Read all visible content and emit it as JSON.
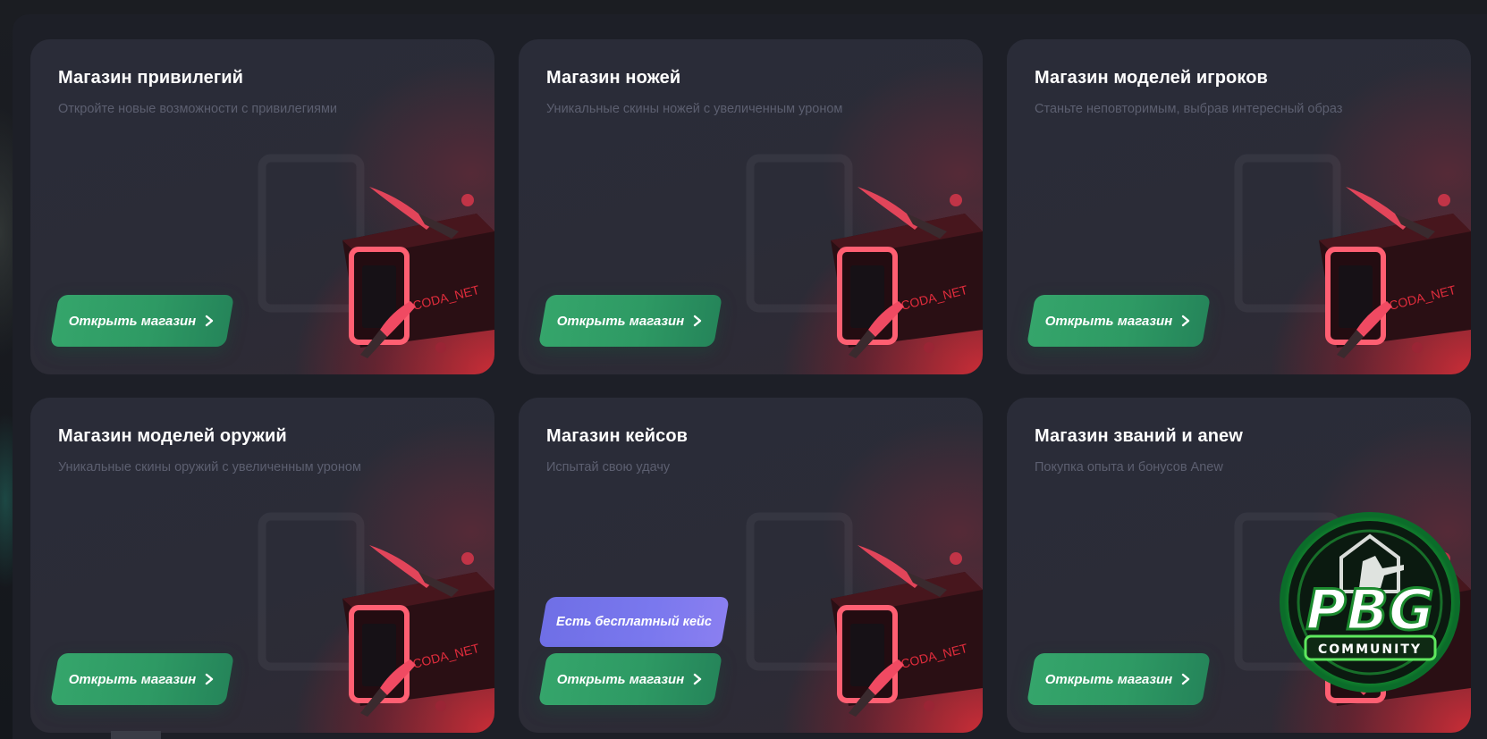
{
  "cards": [
    {
      "title": "Магазин привилегий",
      "subtitle": "Откройте новые возможности с привилегиями",
      "button_label": "Открыть магазин"
    },
    {
      "title": "Магазин ножей",
      "subtitle": "Уникальные скины ножей с увеличенным уроном",
      "button_label": "Открыть магазин"
    },
    {
      "title": "Магазин моделей игроков",
      "subtitle": "Станьте неповторимым, выбрав интересный образ",
      "button_label": "Открыть магазин"
    },
    {
      "title": "Магазин моделей оружий",
      "subtitle": "Уникальные скины оружий с увеличенным уроном",
      "button_label": "Открыть магазин"
    },
    {
      "title": "Магазин кейсов",
      "subtitle": "Испытай свою удачу",
      "button_label": "Открыть магазин",
      "badge_label": "Есть бесплатный кейс"
    },
    {
      "title": "Магазин званий и anew",
      "subtitle": "Покупка опыта и бонусов Anew",
      "button_label": "Открыть магазин"
    }
  ],
  "case_art": {
    "icon": "case-with-knives-icon",
    "case_text": "CODA_NET"
  },
  "watermark": {
    "icon": "pbg-community-logo-icon",
    "text": "PBG",
    "subtext": "COMMUNITY"
  },
  "colors": {
    "button": "#2e9a64",
    "badge": "#7373ea",
    "card_glow": "#d22d37",
    "logo_green": "#3fd13a"
  }
}
